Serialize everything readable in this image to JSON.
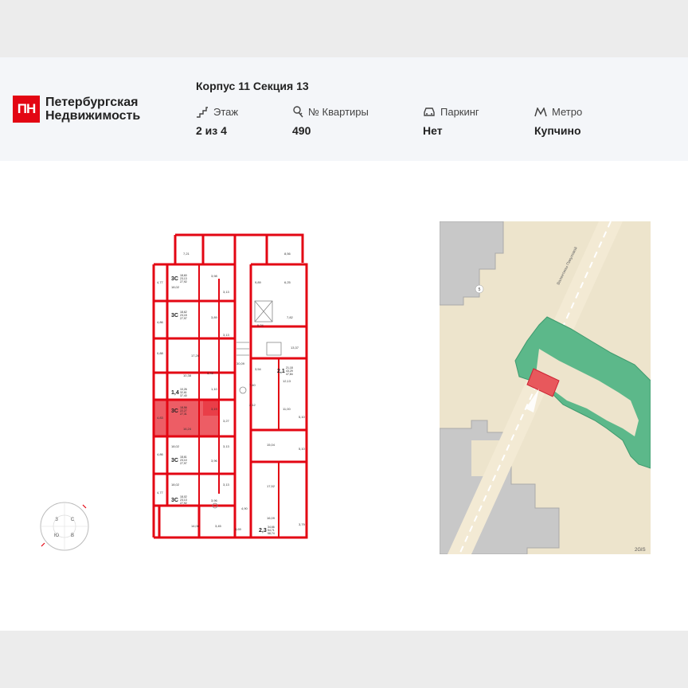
{
  "brand": {
    "line1": "Петербургская",
    "line2": "Недвижимость",
    "mark": "ПН"
  },
  "header": {
    "title": "Корпус 11 Секция 13",
    "floor": {
      "label": "Этаж",
      "value": "2 из 4",
      "icon": "stairs-icon"
    },
    "apartment": {
      "label": "№ Квартиры",
      "value": "490",
      "icon": "key-icon"
    },
    "parking": {
      "label": "Паркинг",
      "value": "Нет",
      "icon": "car-icon"
    },
    "metro": {
      "label": "Метро",
      "value": "Купчино",
      "icon": "metro-icon"
    }
  },
  "plan": {
    "highlight_color": "#e30613",
    "rooms": [
      {
        "type": "3С",
        "areas": [
          "18,60",
          "23,13",
          "27,92"
        ]
      },
      {
        "type": "3С",
        "areas": [
          "18,62",
          "23,15",
          "27,97"
        ]
      },
      {
        "type": "1,4",
        "areas": [
          "10,26",
          "32,61",
          "37,40"
        ]
      },
      {
        "type": "3С",
        "areas": [
          "18,56",
          "22,27",
          "27,31"
        ],
        "highlighted": true
      },
      {
        "type": "3С",
        "areas": [
          "18,61",
          "23,10",
          "27,97"
        ]
      },
      {
        "type": "3С",
        "areas": [
          "18,02",
          "23,13",
          "27,92"
        ]
      },
      {
        "type": "2,1",
        "areas": [
          "21,18",
          "43,29",
          "47,84"
        ]
      },
      {
        "type": "2,3",
        "areas": [
          "34,66",
          "54,71",
          "58,74"
        ]
      }
    ],
    "labels": [
      "7,21",
      "8,56",
      "4,77",
      "3,98",
      "18,02",
      "9,89",
      "6,25",
      "3,13",
      "4,86",
      "3,89",
      "5,24",
      "7,82",
      "0,88",
      "17,26",
      "13,37",
      "3,13",
      "10,38",
      "3,45",
      "30,09",
      "3,54",
      "12,13",
      "1,10",
      "7,40",
      "4,83",
      "3,19",
      "3,27",
      "2,12",
      "11,00",
      "16,24",
      "5,10",
      "4,86",
      "18,02",
      "3,13",
      "15,04",
      "3,96",
      "5,10",
      "4,77",
      "18,02",
      "3,13",
      "17,52",
      "3,96",
      "4,90",
      "16,09",
      "14,06",
      "3,45",
      "3,69",
      "3,79"
    ]
  },
  "compass": {
    "letters": [
      "С",
      "В",
      "Ю",
      "З"
    ]
  },
  "map": {
    "street": "Валентины Пикуловой",
    "building_number": "5",
    "attribution": "2GIS",
    "building_color": "#5cb88a",
    "highlight_color": "#e8585c"
  }
}
